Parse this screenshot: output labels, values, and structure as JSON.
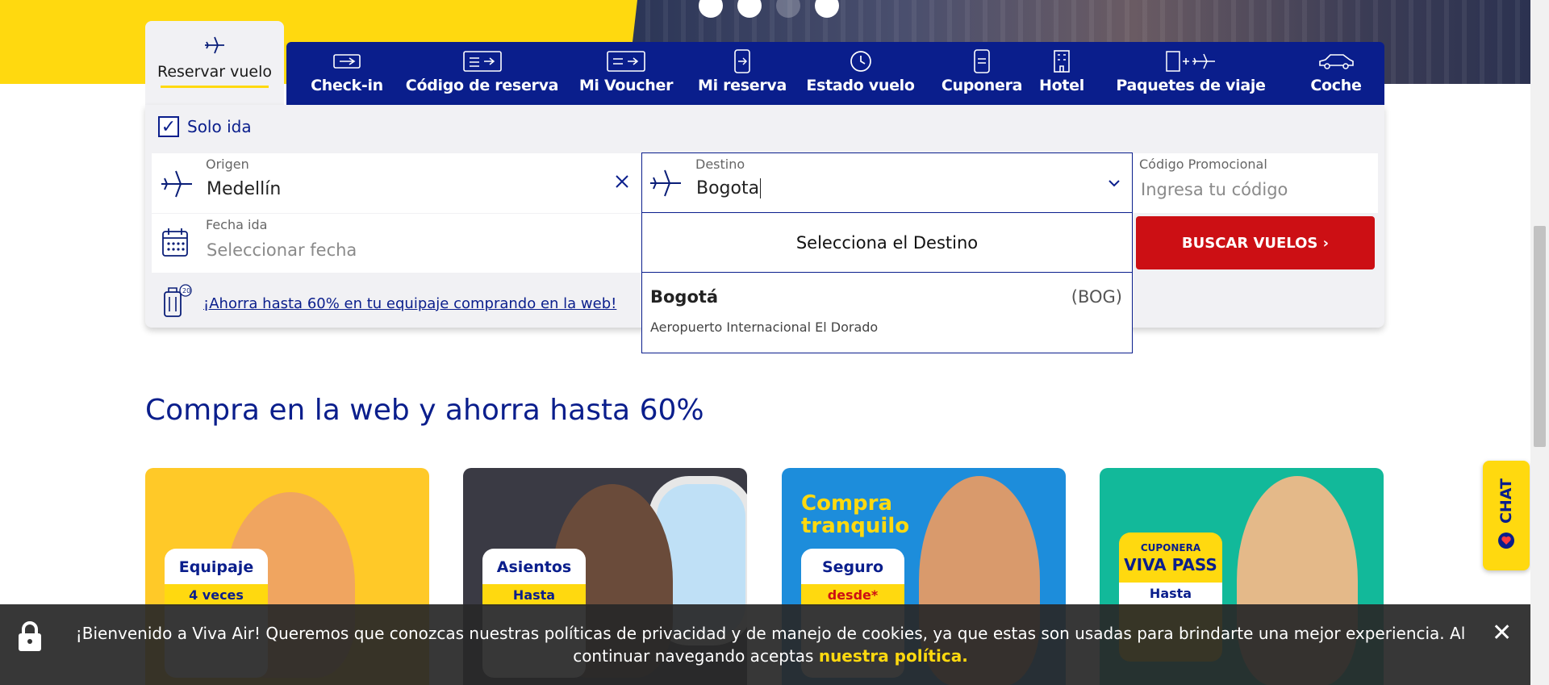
{
  "tabs": {
    "active": {
      "label": "Reservar vuelo",
      "icon": "plane-icon"
    },
    "items": [
      {
        "label": "Check-in",
        "icon": "boarding-pass-icon"
      },
      {
        "label": "Código de reserva",
        "icon": "ticket-icon"
      },
      {
        "label": "Mi Voucher",
        "icon": "voucher-icon"
      },
      {
        "label": "Mi reserva",
        "icon": "mobile-booking-icon"
      },
      {
        "label": "Estado vuelo",
        "icon": "clock-icon"
      },
      {
        "label": "Cuponera",
        "icon": "coupon-phone-icon"
      },
      {
        "label": "Hotel",
        "icon": "hotel-icon"
      },
      {
        "label": "Paquetes de viaje",
        "icon": "package-icon"
      },
      {
        "label": "Coche",
        "icon": "car-icon"
      }
    ]
  },
  "booking": {
    "one_way_label": "Solo ida",
    "one_way_checked": true,
    "origin": {
      "label": "Origen",
      "value": "Medellín"
    },
    "destination": {
      "label": "Destino",
      "value": "Bogota"
    },
    "date": {
      "label": "Fecha ida",
      "placeholder": "Seleccionar fecha"
    },
    "promo": {
      "label": "Código Promocional",
      "placeholder": "Ingresa tu código"
    },
    "search_button": "BUSCAR VUELOS ›",
    "luggage_link": "¡Ahorra hasta 60% en tu equipaje comprando en la web!"
  },
  "dropdown": {
    "header": "Selecciona el Destino",
    "options": [
      {
        "city": "Bogotá",
        "code": "(BOG)",
        "airport": "Aeropuerto Internacional El Dorado"
      }
    ]
  },
  "section_title": "Compra en la web y ahorra hasta 60%",
  "cards": [
    {
      "badge_title": "Equipaje",
      "badge_sub": "4 veces"
    },
    {
      "badge_title": "Asientos",
      "badge_sub": "Hasta"
    },
    {
      "headline": "Compra tranquilo",
      "badge_title": "Seguro",
      "badge_sub": "desde*"
    },
    {
      "headline": "VIVA PASS",
      "badge_title": "CUPONERA",
      "badge_sub": "Hasta"
    }
  ],
  "chat_label": "CHAT",
  "cookie": {
    "message": "¡Bienvenido a Viva Air! Queremos que conozcas nuestras políticas de privacidad y de manejo de cookies, ya que estas son usadas para brindarte una mejor experiencia. Al continuar navegando aceptas",
    "policy_link": "nuestra política."
  },
  "colors": {
    "brand_yellow": "#ffd90f",
    "brand_blue": "#0a1e8c",
    "cta_red": "#cc0f14"
  }
}
